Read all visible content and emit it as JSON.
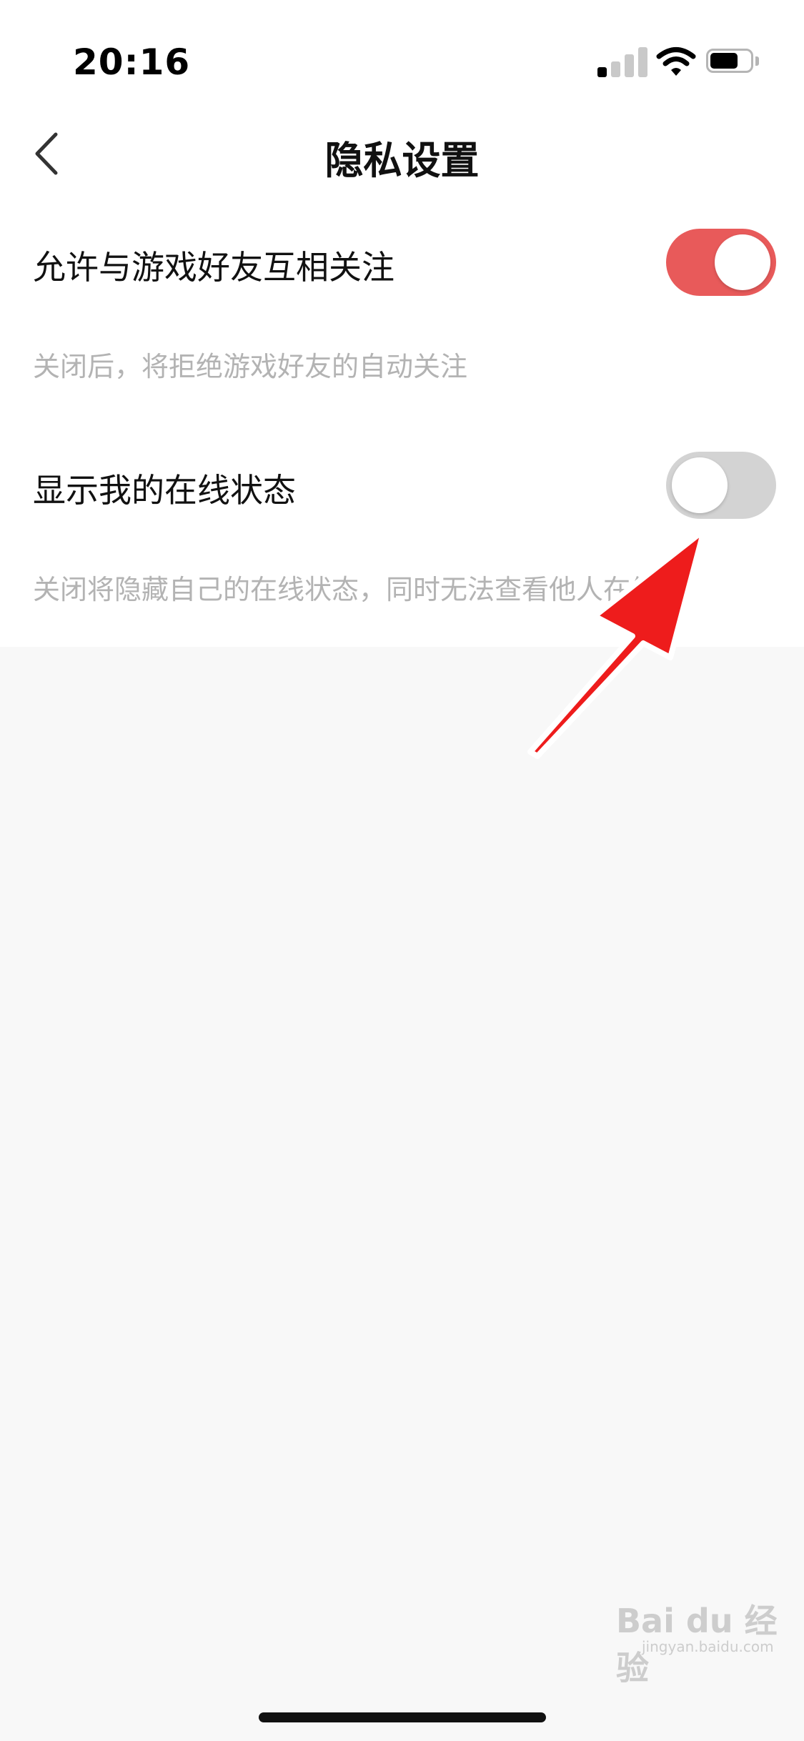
{
  "status_bar": {
    "time": "20:16"
  },
  "nav": {
    "title": "隐私设置",
    "back_icon": "chevron-left-icon"
  },
  "settings": [
    {
      "label": "允许与游戏好友互相关注",
      "description": "关闭后，将拒绝游戏好友的自动关注",
      "enabled": true
    },
    {
      "label": "显示我的在线状态",
      "description": "关闭将隐藏自己的在线状态，同时无法查看他人在线",
      "enabled": false
    }
  ],
  "colors": {
    "toggle_on": "#e85a5a",
    "toggle_off": "#d3d3d3",
    "arrow": "#ee1c1c"
  },
  "watermark": {
    "text": "Bai du 经验",
    "sub": "jingyan.baidu.com"
  }
}
